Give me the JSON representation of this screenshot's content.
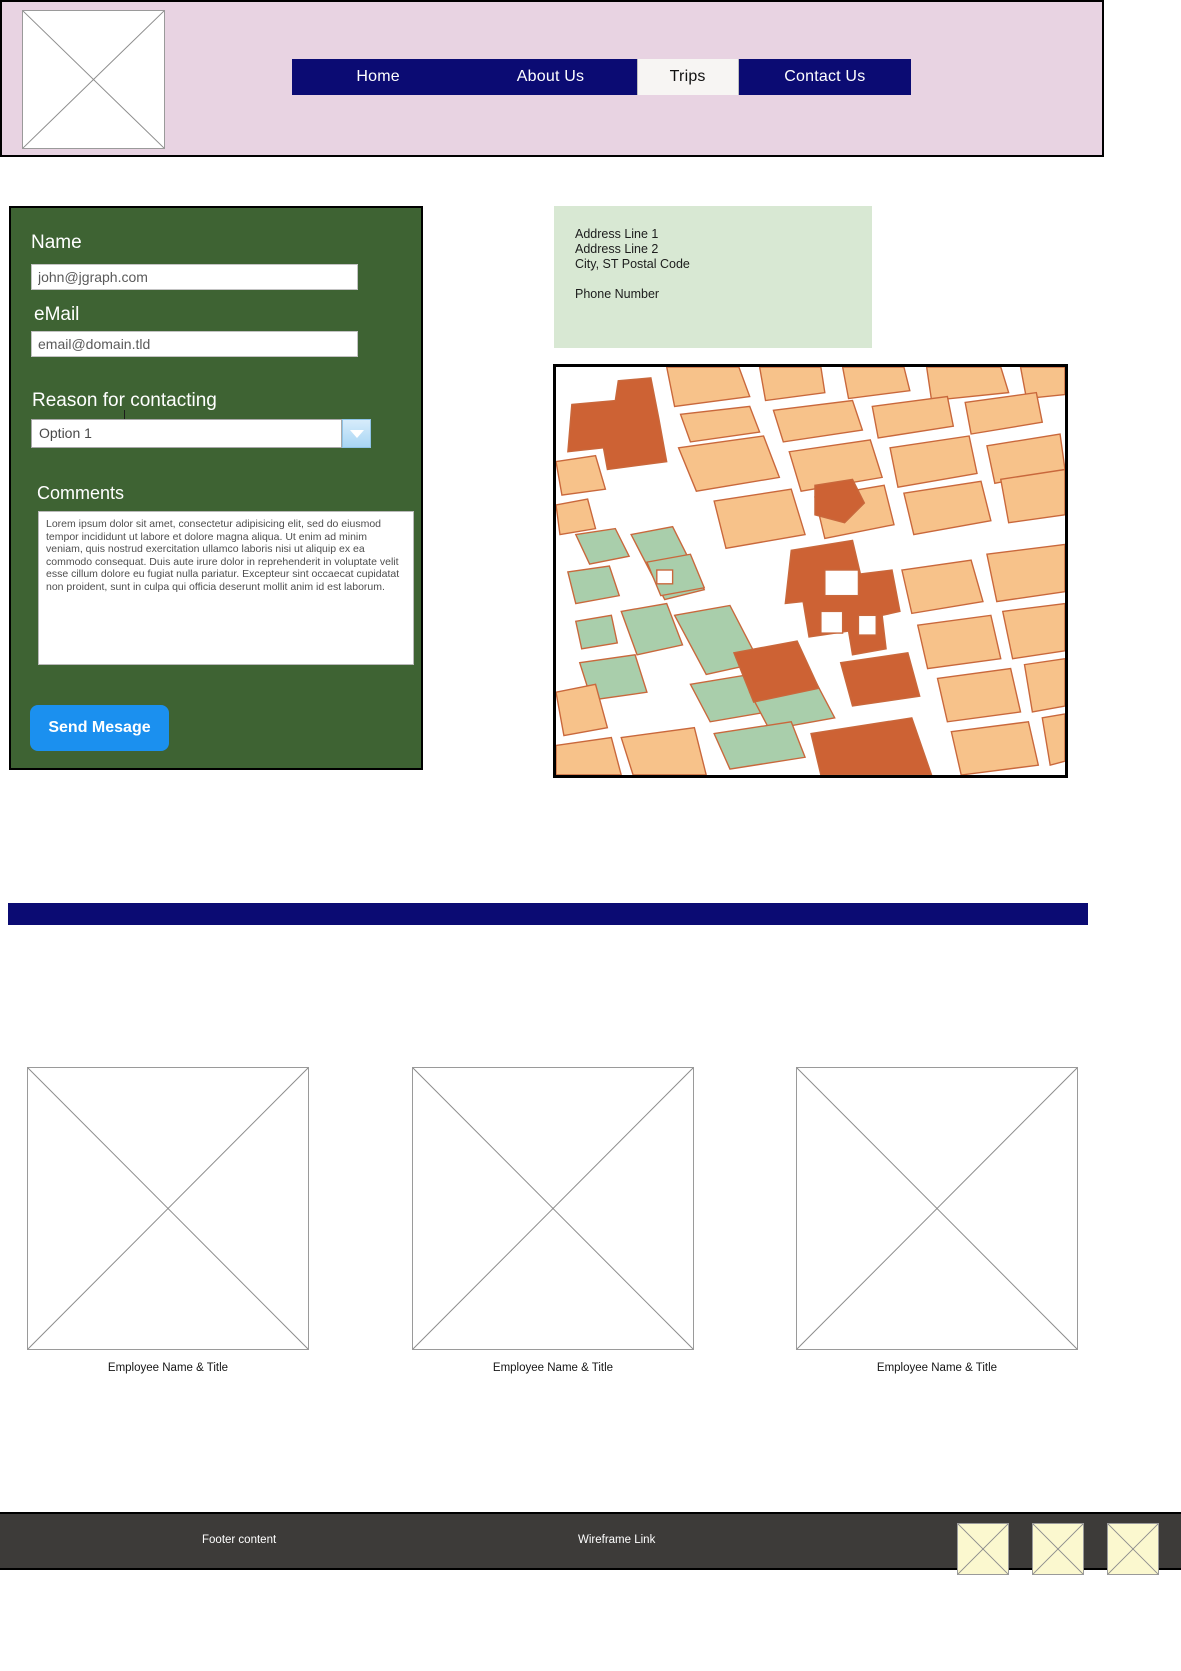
{
  "header": {
    "logo_placeholder": "logo-placeholder",
    "nav": [
      {
        "label": "Home",
        "active": false
      },
      {
        "label": "About Us",
        "active": false
      },
      {
        "label": "Trips",
        "active": true
      },
      {
        "label": "Contact Us",
        "active": false
      }
    ]
  },
  "form": {
    "name_label": "Name",
    "name_value": "john@jgraph.com",
    "email_label": "eMail",
    "email_value": "email@domain.tld",
    "reason_label": "Reason for contacting",
    "reason_selected": "Option 1",
    "comments_label": "Comments",
    "comments_value": "Lorem ipsum dolor sit amet, consectetur adipisicing elit, sed do eiusmod tempor incididunt ut labore et dolore magna aliqua. Ut enim ad minim veniam, quis nostrud exercitation ullamco laboris nisi ut aliquip ex ea commodo consequat. Duis aute irure dolor in reprehenderit in voluptate velit esse cillum dolore eu fugiat nulla pariatur. Excepteur sint occaecat cupidatat non proident, sunt in culpa qui officia deserunt mollit anim id est laborum.",
    "send_label": "Send Mesage"
  },
  "address": {
    "line1": "Address Line 1",
    "line2": "Address Line 2",
    "line3": "City, ST  Postal Code",
    "phone": "Phone Number"
  },
  "map": {
    "alt": "street-map"
  },
  "employees": [
    {
      "label": "Employee Name & Title"
    },
    {
      "label": "Employee Name & Title"
    },
    {
      "label": "Employee Name & Title"
    }
  ],
  "footer": {
    "content_label": "Footer content",
    "link_label": "Wireframe Link",
    "thumbs": [
      {
        "name": "footer-thumb-1"
      },
      {
        "name": "footer-thumb-2"
      },
      {
        "name": "footer-thumb-3"
      }
    ]
  },
  "colors": {
    "header_bg": "#e8d3e2",
    "navy": "#0b0b73",
    "form_green": "#3e6333",
    "address_green": "#d8e8d3",
    "button_blue": "#1b90ef",
    "footer_gray": "#3d3b39",
    "thumb_yellow": "#fbf8cf",
    "map_building": "#f7c28a",
    "map_block": "#cd6234",
    "map_park": "#a9ceab"
  }
}
